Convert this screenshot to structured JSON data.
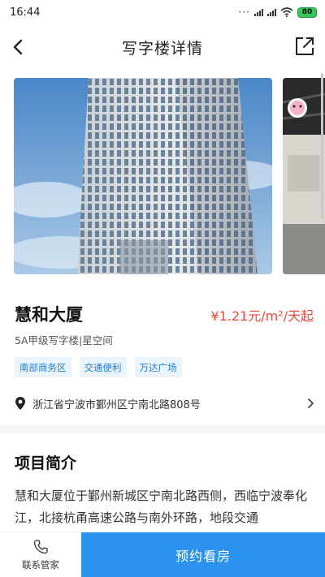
{
  "status_bar": {
    "time": "16:44",
    "battery": "80"
  },
  "nav": {
    "title": "写字楼详情"
  },
  "building": {
    "name": "慧和大厦",
    "price": "¥1.21元/m²/天起",
    "subtitle": "5A甲级写字楼|星空间",
    "tags": [
      "南部商务区",
      "交通便利",
      "万达广场"
    ],
    "address": "浙江省宁波市鄞州区宁南北路808号"
  },
  "intro": {
    "title": "项目简介",
    "text": "慧和大厦位于鄞州新城区宁南北路西侧，西临宁波奉化江，北接杭甬高速公路与南外环路，地段交通"
  },
  "bottom": {
    "contact_label": "联系管家",
    "book_label": "预约看房"
  },
  "icons": {
    "back": "back-arrow-icon",
    "share": "share-icon",
    "pin": "location-pin-icon",
    "chevron": "chevron-right-icon",
    "phone": "phone-icon"
  },
  "colors": {
    "price": "#e84b3c",
    "tag_text": "#1a7fd9",
    "tag_bg": "#eaf4fd",
    "primary_button": "#2b92f0"
  }
}
